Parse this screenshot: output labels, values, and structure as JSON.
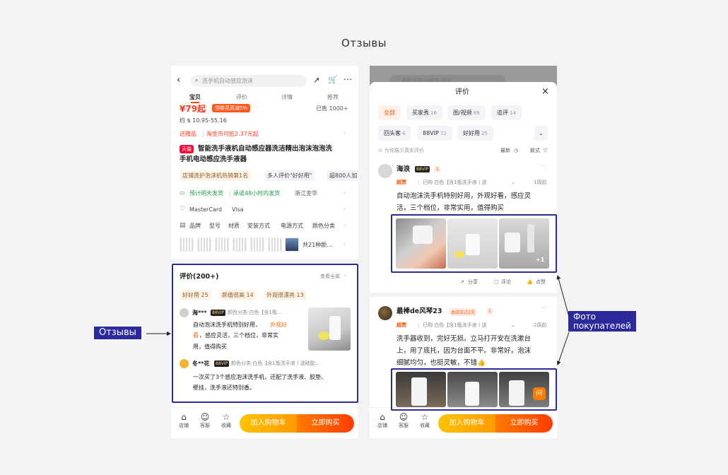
{
  "page": {
    "title": "Отзывы"
  },
  "callouts": {
    "left": "Отзывы",
    "right_line1": "Фото",
    "right_line2": "покупателей"
  },
  "left": {
    "search_placeholder": "洗手机自动感应泡沫",
    "tabs": [
      "宝贝",
      "评价",
      "详情",
      "推荐"
    ],
    "price": "¥79起",
    "promo_badge": "领券至高减5%",
    "sold": "已售 1000+",
    "usd_price": "约 $ 10.95-55.16",
    "gift_line_a": "送赠品",
    "gift_line_b": "淘金币可抵2.37元起",
    "tmall_badge": "天猫",
    "product_title_1": "智能洗手液机自动感应器洗洁精出泡沫泡泡洗",
    "product_title_2": "手机电动感应洗手液器",
    "tags": [
      "店铺洗护泡沫机热销第1名",
      "多人评价\"好好用\"",
      "超800人加"
    ],
    "shipping_a": "预计明天发货",
    "shipping_b": "承诺48小时内发货",
    "shipping_c": "浙江金华",
    "payment_a": "MasterCard",
    "payment_b": "Visa",
    "params": [
      "品牌",
      "型号",
      "材质",
      "安装方式",
      "电源方式",
      "颜色分类"
    ],
    "variants_more": "共21种颜...",
    "reviews": {
      "heading": "评价(200+)",
      "view_all": "查看全部",
      "chips": [
        "好好用 25",
        "颜值很高 14",
        "外观很漂亮 13"
      ],
      "r1_user": "海***",
      "r1_vip": "88VIP",
      "r1_spec": "颜色分类:白色【含1瓶...",
      "r1_text_1a": "自动泡沫洗手机特别好用，",
      "r1_text_1b": "外观好",
      "r1_text_2a": "看",
      "r1_text_2b": "，感应灵活，三个档位，非常实",
      "r1_text_3": "用，值得购买",
      "r2_user": "冬**花",
      "r2_vip": "88VIP",
      "r2_spec": "颜色分类:白色【含1瓶洗手液丨送硅胶...",
      "r2_text_1": "一次买了3个感应泡沫洗手机，还配了洗手液、胶垫、",
      "r2_text_2": "壁挂，洗手液还特别香。"
    },
    "bottom": {
      "shop": "店铺",
      "service": "客服",
      "favorite": "收藏",
      "add_cart": "加入购物车",
      "buy_now": "立即购买"
    }
  },
  "right": {
    "top_search": "洗手机自动感应泡沫",
    "sheet_title": "评价",
    "filters_row1": [
      {
        "label": "全部",
        "count": ""
      },
      {
        "label": "买家秀",
        "count": "16"
      },
      {
        "label": "图/视频",
        "count": "69"
      },
      {
        "label": "追评",
        "count": "14"
      }
    ],
    "filters_row2": [
      {
        "label": "回头客",
        "count": "4"
      },
      {
        "label": "88VIP",
        "count": "72"
      },
      {
        "label": "好好用",
        "count": "25"
      }
    ],
    "authentic_note": "为你展示真实评价",
    "sort_latest": "最新",
    "sort_style": "款式",
    "review1": {
      "user": "海浪",
      "vip": "88VIP",
      "level": "1",
      "praise": "超赞",
      "spec": "已购 白色【含1瓶洗手液丨送",
      "time": "1周前",
      "text_1": "自动泡沫洗手机特别好用，外观好看，感应灵",
      "text_2": "活，三个档位，非常实用，值得购买",
      "more_count": "+1",
      "share": "分享",
      "comment": "评论",
      "like": "点赞"
    },
    "review2": {
      "user": "最棒de风琴23",
      "badge": "本店买过2次",
      "level": "1",
      "praise": "超赞",
      "spec": "已购 白色【含1瓶洗手液丨送",
      "time": "2周前",
      "text_1": "洗手器收到，完好无损。立马打开安在洗漱台",
      "text_2": "上，用了底托，因为台面不平。非常好，泡沫",
      "text_3": "细腻均匀，也挺灵敏，不错👍",
      "ask": "问"
    },
    "bottom": {
      "shop": "店铺",
      "service": "客服",
      "favorite": "收藏",
      "add_cart": "加入购物车",
      "buy_now": "立即购买"
    }
  }
}
